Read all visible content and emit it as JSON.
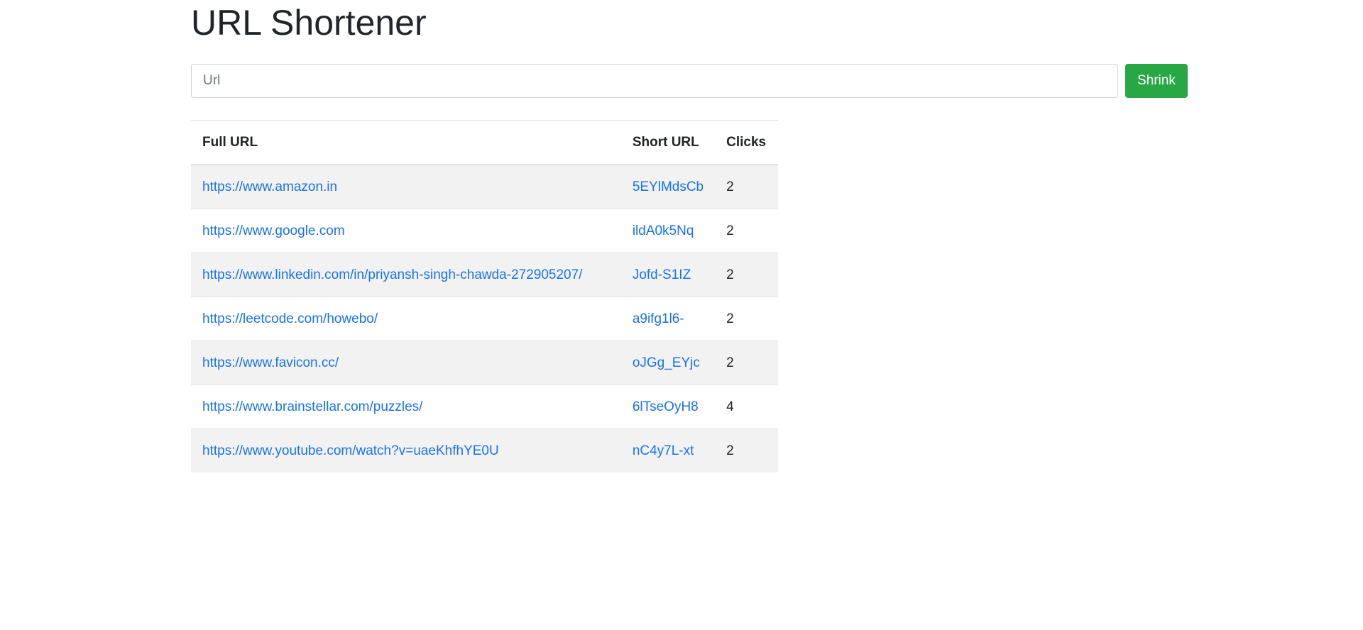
{
  "header": {
    "title": "URL Shortener"
  },
  "form": {
    "url_placeholder": "Url",
    "url_value": "",
    "shrink_label": "Shrink"
  },
  "table": {
    "columns": [
      "Full URL",
      "Short URL",
      "Clicks"
    ],
    "rows": [
      {
        "full": "https://www.amazon.in",
        "short": "5EYlMdsCb",
        "clicks": "2"
      },
      {
        "full": "https://www.google.com",
        "short": "ildA0k5Nq",
        "clicks": "2"
      },
      {
        "full": "https://www.linkedin.com/in/priyansh-singh-chawda-272905207/",
        "short": "Jofd-S1IZ",
        "clicks": "2"
      },
      {
        "full": "https://leetcode.com/howebo/",
        "short": "a9ifg1l6-",
        "clicks": "2"
      },
      {
        "full": "https://www.favicon.cc/",
        "short": "oJGg_EYjc",
        "clicks": "2"
      },
      {
        "full": "https://www.brainstellar.com/puzzles/",
        "short": "6lTseOyH8",
        "clicks": "4"
      },
      {
        "full": "https://www.youtube.com/watch?v=uaeKhfhYE0U",
        "short": "nC4y7L-xt",
        "clicks": "2"
      }
    ]
  },
  "colors": {
    "link": "#1a73e8",
    "button": "#28a745",
    "stripe": "#f2f2f2"
  }
}
